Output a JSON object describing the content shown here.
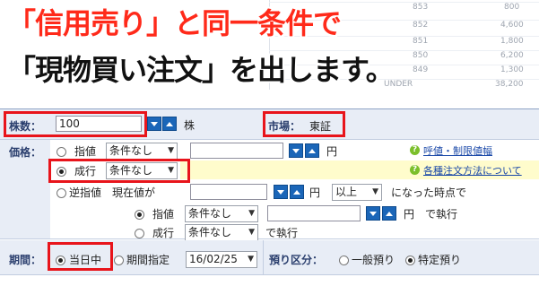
{
  "headline": {
    "line1": "「信用売り」と同一条件で",
    "line2": "「現物買い注文」を出します。"
  },
  "background_table": {
    "rows": [
      {
        "code": "853",
        "value": "800"
      },
      {
        "code": "852",
        "value": "4,600"
      },
      {
        "code": "851",
        "value": "1,800"
      },
      {
        "code": "850",
        "value": "6,200"
      },
      {
        "code": "849",
        "value": "1,300"
      },
      {
        "code": "UNDER",
        "value": "38,200"
      }
    ]
  },
  "form": {
    "quantity": {
      "label": "株数：",
      "value": "100",
      "unit": "株"
    },
    "market": {
      "label": "市場：",
      "value": "東証"
    },
    "price": {
      "label": "価格：",
      "limit": {
        "label": "指値",
        "condition": "条件なし",
        "unit": "円"
      },
      "market_order": {
        "label": "成行",
        "condition": "条件なし"
      },
      "stop": {
        "label": "逆指値",
        "prefix": "現在値が",
        "unit": "円",
        "direction": "以上",
        "suffix": "になった時点で"
      },
      "stop_limit": {
        "label": "指値",
        "condition": "条件なし",
        "unit": "円",
        "suffix": "で執行"
      },
      "stop_market": {
        "label": "成行",
        "condition": "条件なし",
        "suffix": "で執行"
      },
      "link_price_limit": "呼値・制限値幅",
      "link_order_types": "各種注文方法について"
    },
    "period": {
      "label": "期間：",
      "today": "当日中",
      "specify": "期間指定",
      "date": "16/02/25"
    },
    "custody": {
      "label": "預り区分：",
      "general": "一般預り",
      "specific": "特定預り"
    }
  },
  "colors": {
    "accent_red": "#ff2a1a",
    "highlight_box": "#e8141b",
    "spinner_blue": "#1b66b8",
    "label_navy": "#2b3f6e"
  },
  "icons": {
    "spinner_down": "triangle-down",
    "spinner_up": "triangle-up",
    "help": "question-circle",
    "dropdown": "chevron-down"
  }
}
